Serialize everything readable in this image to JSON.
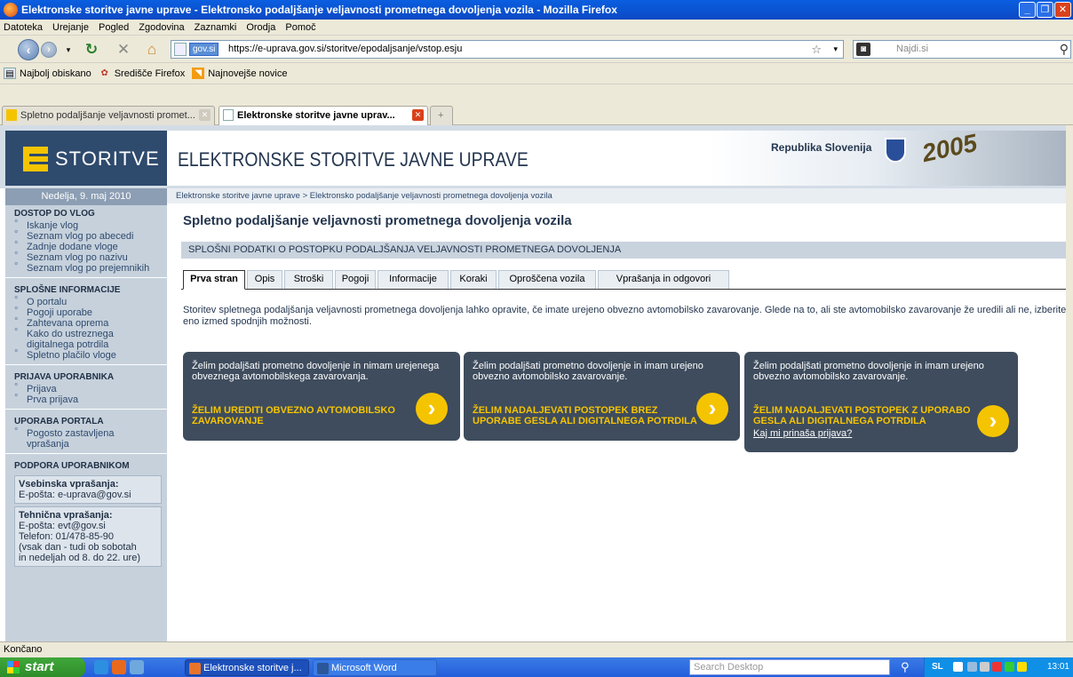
{
  "window": {
    "title": "Elektronske storitve javne uprave - Elektronsko podaljšanje veljavnosti prometnega dovoljenja vozila - Mozilla Firefox"
  },
  "menu": [
    "Datoteka",
    "Urejanje",
    "Pogled",
    "Zgodovina",
    "Zaznamki",
    "Orodja",
    "Pomoč"
  ],
  "address": {
    "badge": "gov.si",
    "url": "https://e-uprava.gov.si/storitve/epodaljsanje/vstop.esju"
  },
  "search": {
    "placeholder": "Najdi.si"
  },
  "bookmarks": [
    "Najbolj obiskano",
    "Središče Firefox",
    "Najnovejše novice"
  ],
  "browser_tabs": [
    {
      "label": "Spletno podaljšanje veljavnosti promet...",
      "active": false
    },
    {
      "label": "Elektronske storitve javne uprav...",
      "active": true
    }
  ],
  "header": {
    "logo_text": "STORITVE",
    "banner_title": "ELEKTRONSKE STORITVE JAVNE UPRAVE",
    "country": "Republika Slovenija",
    "decor_text": "2005"
  },
  "sidebar": {
    "date": "Nedelja, 9. maj 2010",
    "sections": [
      {
        "title": "DOSTOP DO VLOG",
        "links": [
          "Iskanje vlog",
          "Seznam vlog po abecedi",
          "Zadnje dodane vloge",
          "Seznam vlog po nazivu",
          "Seznam vlog po prejemnikih"
        ]
      },
      {
        "title": "SPLOŠNE INFORMACIJE",
        "links": [
          "O portalu",
          "Pogoji uporabe",
          "Zahtevana oprema",
          "Kako do ustreznega digitalnega potrdila",
          "Spletno plačilo vloge"
        ]
      },
      {
        "title": "PRIJAVA UPORABNIKA",
        "links": [
          "Prijava",
          "Prva prijava"
        ]
      },
      {
        "title": "UPORABA PORTALA",
        "links": [
          "Pogosto zastavljena vprašanja"
        ]
      }
    ],
    "support": {
      "title": "PODPORA UPORABNIKOM",
      "content_title": "Vsebinska vprašanja:",
      "content_email": "E-pošta: e-uprava@gov.si",
      "tech_title": "Tehnična vprašanja:",
      "tech_email": "E-pošta: evt@gov.si",
      "tech_phone": "Telefon: 01/478-85-90",
      "tech_hours1": "(vsak dan - tudi ob sobotah",
      "tech_hours2": "in nedeljah od 8. do 22. ure)"
    }
  },
  "content": {
    "breadcrumb": "Elektronske storitve javne uprave > Elektronsko podaljšanje veljavnosti prometnega dovoljenja vozila",
    "title": "Spletno podaljšanje veljavnosti prometnega dovoljenja vozila",
    "section_bar": "SPLOŠNI PODATKI O POSTOPKU PODALJŠANJA VELJAVNOSTI PROMETNEGA DOVOLJENJA",
    "tabs": [
      "Prva stran",
      "Opis",
      "Stroški",
      "Pogoji",
      "Informacije",
      "Koraki",
      "Oproščena vozila",
      "Vprašanja in odgovori"
    ],
    "active_tab": "Prva stran",
    "intro": "Storitev spletnega podaljšanja veljavnosti prometnega dovoljenja lahko opravite, če imate urejeno obvezno avtomobilsko zavarovanje. Glede na to, ali ste avtomobilsko zavarovanje že uredili ali ne, izberite eno izmed spodnjih možnosti.",
    "options": [
      {
        "desc": "Želim podaljšati prometno dovoljenje in nimam urejenega obveznega avtomobilskega zavarovanja.",
        "action1": "ŽELIM UREDITI OBVEZNO AVTOMOBILSKO",
        "action2": "ZAVAROVANJE"
      },
      {
        "desc": "Želim podaljšati prometno dovoljenje in imam urejeno obvezno avtomobilsko zavarovanje.",
        "action1": "ŽELIM NADALJEVATI POSTOPEK BREZ",
        "action2": "UPORABE GESLA ALI DIGITALNEGA POTRDILA"
      },
      {
        "desc": "Želim podaljšati prometno dovoljenje in imam urejeno obvezno avtomobilsko zavarovanje.",
        "action1": "ŽELIM NADALJEVATI POSTOPEK Z UPORABO",
        "action2": "GESLA ALI DIGITALNEGA POTRDILA",
        "link": "Kaj mi prinaša prijava?"
      }
    ]
  },
  "status": "Končano",
  "taskbar": {
    "start": "start",
    "buttons": [
      "Elektronske storitve j...",
      "Microsoft Word"
    ],
    "search_placeholder": "Search Desktop",
    "lang": "SL",
    "clock": "13:01"
  },
  "colors": {
    "accent_yellow": "#f5c400",
    "card_bg": "#3e4c5d",
    "sidebar_bg": "#c6d1dc",
    "logo_bg": "#2e4a6d",
    "link": "#2f4a6e"
  }
}
